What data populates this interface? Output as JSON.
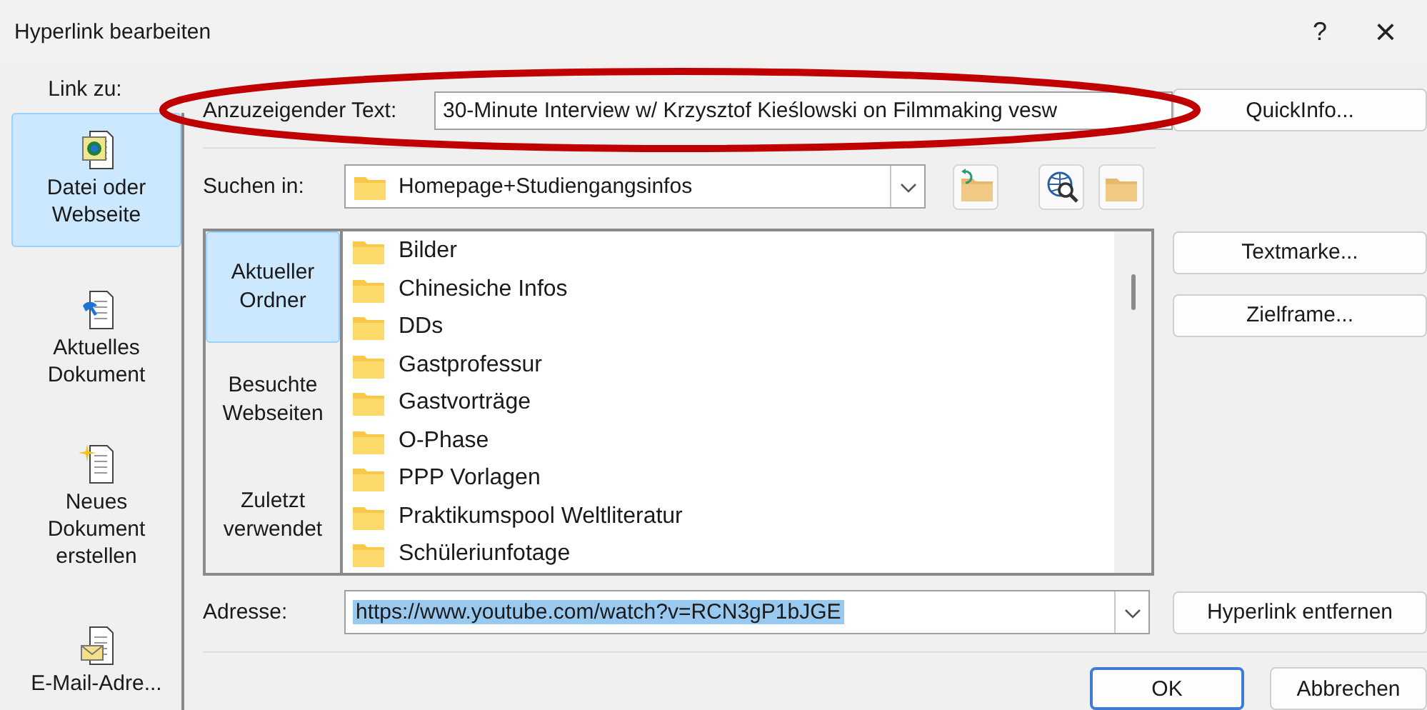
{
  "window": {
    "title": "Hyperlink bearbeiten",
    "help": "?",
    "close": "×"
  },
  "link_to": {
    "label": "Link zu:",
    "items": [
      {
        "kind": "file",
        "label": "Datei oder Webseite",
        "selected": true
      },
      {
        "kind": "document",
        "label": "Aktuelles Dokument",
        "selected": false
      },
      {
        "kind": "new",
        "label": "Neues Dokument erstellen",
        "selected": false
      },
      {
        "kind": "mail",
        "label": "E-Mail-Adre...",
        "selected": false
      }
    ]
  },
  "display_text": {
    "label": "Anzuzeigender Text:",
    "value": "30-Minute Interview w/ Krzysztof Kieślowski on Filmmaking vesw"
  },
  "quickinfo_button": "QuickInfo...",
  "look_in": {
    "label": "Suchen in:",
    "value": "Homepage+Studiengangsinfos"
  },
  "browse_nav": [
    {
      "label": "Aktueller Ordner",
      "selected": true
    },
    {
      "label": "Besuchte Webseiten",
      "selected": false
    },
    {
      "label": "Zuletzt verwendet",
      "selected": false
    }
  ],
  "folders": [
    "Bilder",
    "Chinesiche Infos",
    "DDs",
    "Gastprofessur",
    "Gastvorträge",
    "O-Phase",
    "PPP Vorlagen",
    "Praktikumspool Weltliteratur",
    "Schüleriunfotage"
  ],
  "side_buttons": [
    "Textmarke...",
    "Zielframe..."
  ],
  "address": {
    "label": "Adresse:",
    "value": "https://www.youtube.com/watch?v=RCN3gP1bJGE",
    "selected": true
  },
  "remove_button": "Hyperlink entfernen",
  "buttons": [
    {
      "label": "OK",
      "kind": "default"
    },
    {
      "label": "Abbrechen",
      "kind": "normal"
    }
  ],
  "annotations": [
    {
      "kind": "ellipse",
      "color": "#c00000"
    }
  ]
}
